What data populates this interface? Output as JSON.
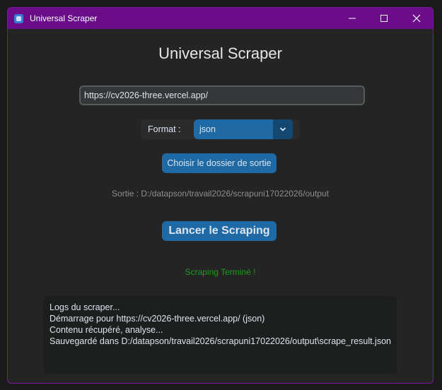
{
  "window": {
    "title": "Universal Scraper",
    "controls": [
      "minimize-icon",
      "maximize-icon",
      "close-icon"
    ]
  },
  "heading": "Universal Scraper",
  "url_input": {
    "value": "https://cv2026-three.vercel.app/"
  },
  "format": {
    "label": "Format :",
    "selected": "json",
    "arrow_icon": "chevron-down-icon"
  },
  "choose_folder_button": "Choisir le dossier de sortie",
  "output_path": "Sortie : D:/datapson/travail2026/scrapuni17022026/output",
  "launch_button": "Lancer le Scraping",
  "status": "Scraping Terminé !",
  "logs": [
    "Logs du scraper...",
    "Démarrage pour https://cv2026-three.vercel.app/ (json)",
    "Contenu récupéré, analyse...",
    "Sauvegardé dans D:/datapson/travail2026/scrapuni17022026/output\\scrape_result.json"
  ],
  "colors": {
    "titlebar": "#6b0d88",
    "accent_button": "#1f6aa5",
    "status_success": "#1e9a1e",
    "background": "#242424"
  }
}
